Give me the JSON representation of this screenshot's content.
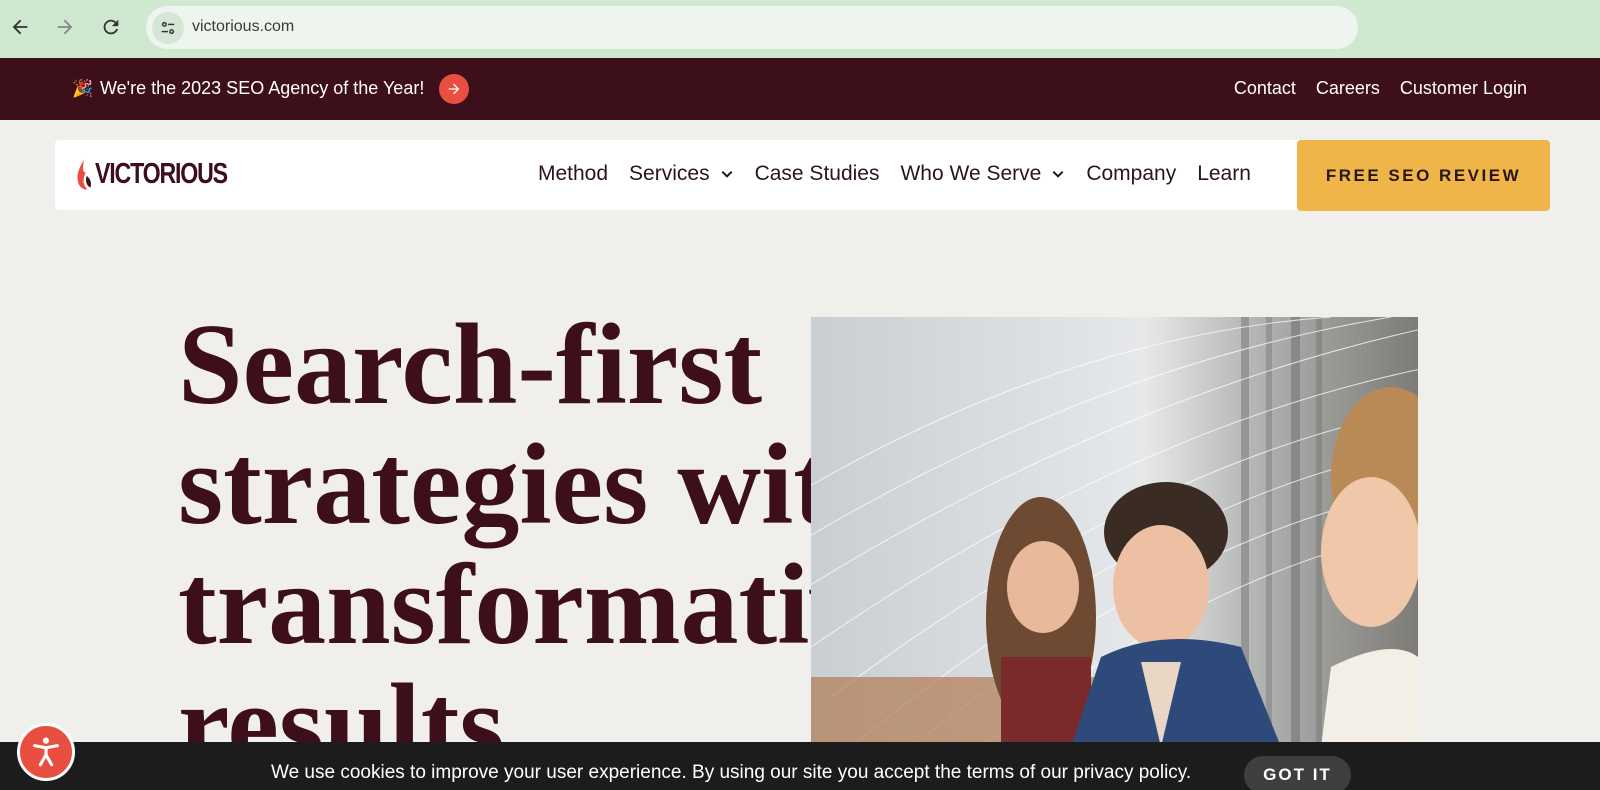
{
  "browser": {
    "url": "victorious.com",
    "icons": [
      "back-arrow-icon",
      "forward-arrow-icon",
      "reload-icon",
      "site-info-icon"
    ]
  },
  "announcement": {
    "icon": "party-popper-icon",
    "text": "We're the 2023 SEO Agency of the Year!",
    "links": [
      "Contact",
      "Careers",
      "Customer Login"
    ]
  },
  "nav": {
    "logo_text": "VICTORIOUS",
    "items": [
      {
        "label": "Method",
        "dropdown": false
      },
      {
        "label": "Services",
        "dropdown": true
      },
      {
        "label": "Case Studies",
        "dropdown": false
      },
      {
        "label": "Who We Serve",
        "dropdown": true
      },
      {
        "label": "Company",
        "dropdown": false
      },
      {
        "label": "Learn",
        "dropdown": false
      }
    ],
    "cta_label": "FREE SEO REVIEW"
  },
  "hero": {
    "title_lines": [
      "Search-first",
      "strategies with",
      "transformative",
      "results"
    ]
  },
  "cookie": {
    "text": "We use cookies to improve your user experience. By using our site you accept the terms of our privacy policy.",
    "button_label": "GOT IT"
  },
  "colors": {
    "brand_dark": "#3d0f1a",
    "accent_red": "#e94f40",
    "cta_yellow": "#efb548",
    "page_bg": "#f0efeb"
  }
}
